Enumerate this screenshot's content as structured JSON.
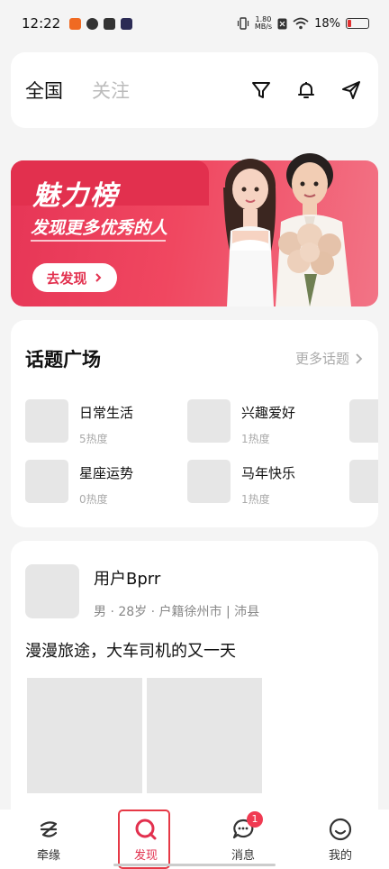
{
  "status_bar": {
    "time": "12:22",
    "speed_top": "1.80",
    "speed_unit": "MB/s",
    "battery": "18%",
    "battery_level": 0.18,
    "icons": [
      "app-notification-icon",
      "app-refresh-icon",
      "mail-icon",
      "app-play-icon",
      "vibrate-icon",
      "network-speed",
      "sim-icon",
      "wifi-icon",
      "battery-icon"
    ]
  },
  "header": {
    "tabs": [
      {
        "label": "全国",
        "active": true
      },
      {
        "label": "关注",
        "active": false
      }
    ],
    "icons": [
      "filter-icon",
      "bell-icon",
      "send-icon"
    ]
  },
  "banner": {
    "title": "魅力榜",
    "subtitle": "发现更多优秀的人",
    "button_label": "去发现",
    "colors": {
      "primary": "#e2304e"
    }
  },
  "topics": {
    "title": "话题广场",
    "more_label": "更多话题",
    "items": [
      {
        "name": "日常生活",
        "heat": "5热度"
      },
      {
        "name": "兴趣爱好",
        "heat": "1热度"
      },
      {
        "name": "星座运势",
        "heat": "0热度"
      },
      {
        "name": "马年快乐",
        "heat": "1热度"
      }
    ]
  },
  "feed": {
    "username": "用户Bprr",
    "info": "男 · 28岁 · 户籍徐州市 | 沛县",
    "text": "漫漫旅途，大车司机的又一天"
  },
  "bottom_nav": {
    "items": [
      {
        "label": "牵缘",
        "icon": "qianyuan-icon",
        "active": false
      },
      {
        "label": "发现",
        "icon": "discover-icon",
        "active": true
      },
      {
        "label": "消息",
        "icon": "message-icon",
        "active": false,
        "badge": "1"
      },
      {
        "label": "我的",
        "icon": "profile-icon",
        "active": false
      }
    ]
  }
}
